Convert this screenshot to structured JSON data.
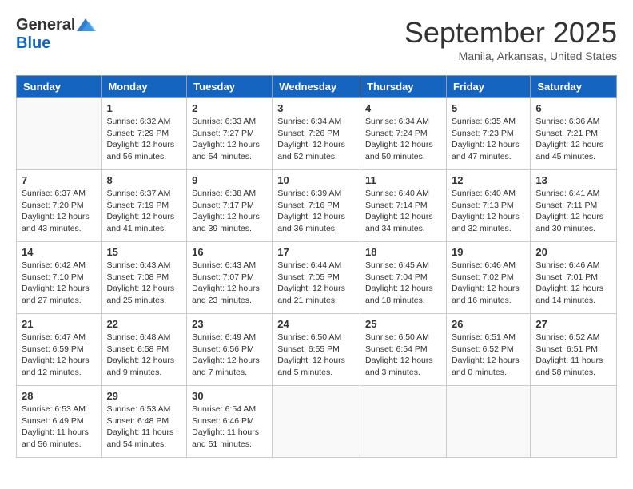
{
  "header": {
    "logo_general": "General",
    "logo_blue": "Blue",
    "title": "September 2025",
    "location": "Manila, Arkansas, United States"
  },
  "columns": [
    "Sunday",
    "Monday",
    "Tuesday",
    "Wednesday",
    "Thursday",
    "Friday",
    "Saturday"
  ],
  "weeks": [
    [
      {
        "day": "",
        "details": ""
      },
      {
        "day": "1",
        "details": "Sunrise: 6:32 AM\nSunset: 7:29 PM\nDaylight: 12 hours\nand 56 minutes."
      },
      {
        "day": "2",
        "details": "Sunrise: 6:33 AM\nSunset: 7:27 PM\nDaylight: 12 hours\nand 54 minutes."
      },
      {
        "day": "3",
        "details": "Sunrise: 6:34 AM\nSunset: 7:26 PM\nDaylight: 12 hours\nand 52 minutes."
      },
      {
        "day": "4",
        "details": "Sunrise: 6:34 AM\nSunset: 7:24 PM\nDaylight: 12 hours\nand 50 minutes."
      },
      {
        "day": "5",
        "details": "Sunrise: 6:35 AM\nSunset: 7:23 PM\nDaylight: 12 hours\nand 47 minutes."
      },
      {
        "day": "6",
        "details": "Sunrise: 6:36 AM\nSunset: 7:21 PM\nDaylight: 12 hours\nand 45 minutes."
      }
    ],
    [
      {
        "day": "7",
        "details": "Sunrise: 6:37 AM\nSunset: 7:20 PM\nDaylight: 12 hours\nand 43 minutes."
      },
      {
        "day": "8",
        "details": "Sunrise: 6:37 AM\nSunset: 7:19 PM\nDaylight: 12 hours\nand 41 minutes."
      },
      {
        "day": "9",
        "details": "Sunrise: 6:38 AM\nSunset: 7:17 PM\nDaylight: 12 hours\nand 39 minutes."
      },
      {
        "day": "10",
        "details": "Sunrise: 6:39 AM\nSunset: 7:16 PM\nDaylight: 12 hours\nand 36 minutes."
      },
      {
        "day": "11",
        "details": "Sunrise: 6:40 AM\nSunset: 7:14 PM\nDaylight: 12 hours\nand 34 minutes."
      },
      {
        "day": "12",
        "details": "Sunrise: 6:40 AM\nSunset: 7:13 PM\nDaylight: 12 hours\nand 32 minutes."
      },
      {
        "day": "13",
        "details": "Sunrise: 6:41 AM\nSunset: 7:11 PM\nDaylight: 12 hours\nand 30 minutes."
      }
    ],
    [
      {
        "day": "14",
        "details": "Sunrise: 6:42 AM\nSunset: 7:10 PM\nDaylight: 12 hours\nand 27 minutes."
      },
      {
        "day": "15",
        "details": "Sunrise: 6:43 AM\nSunset: 7:08 PM\nDaylight: 12 hours\nand 25 minutes."
      },
      {
        "day": "16",
        "details": "Sunrise: 6:43 AM\nSunset: 7:07 PM\nDaylight: 12 hours\nand 23 minutes."
      },
      {
        "day": "17",
        "details": "Sunrise: 6:44 AM\nSunset: 7:05 PM\nDaylight: 12 hours\nand 21 minutes."
      },
      {
        "day": "18",
        "details": "Sunrise: 6:45 AM\nSunset: 7:04 PM\nDaylight: 12 hours\nand 18 minutes."
      },
      {
        "day": "19",
        "details": "Sunrise: 6:46 AM\nSunset: 7:02 PM\nDaylight: 12 hours\nand 16 minutes."
      },
      {
        "day": "20",
        "details": "Sunrise: 6:46 AM\nSunset: 7:01 PM\nDaylight: 12 hours\nand 14 minutes."
      }
    ],
    [
      {
        "day": "21",
        "details": "Sunrise: 6:47 AM\nSunset: 6:59 PM\nDaylight: 12 hours\nand 12 minutes."
      },
      {
        "day": "22",
        "details": "Sunrise: 6:48 AM\nSunset: 6:58 PM\nDaylight: 12 hours\nand 9 minutes."
      },
      {
        "day": "23",
        "details": "Sunrise: 6:49 AM\nSunset: 6:56 PM\nDaylight: 12 hours\nand 7 minutes."
      },
      {
        "day": "24",
        "details": "Sunrise: 6:50 AM\nSunset: 6:55 PM\nDaylight: 12 hours\nand 5 minutes."
      },
      {
        "day": "25",
        "details": "Sunrise: 6:50 AM\nSunset: 6:54 PM\nDaylight: 12 hours\nand 3 minutes."
      },
      {
        "day": "26",
        "details": "Sunrise: 6:51 AM\nSunset: 6:52 PM\nDaylight: 12 hours\nand 0 minutes."
      },
      {
        "day": "27",
        "details": "Sunrise: 6:52 AM\nSunset: 6:51 PM\nDaylight: 11 hours\nand 58 minutes."
      }
    ],
    [
      {
        "day": "28",
        "details": "Sunrise: 6:53 AM\nSunset: 6:49 PM\nDaylight: 11 hours\nand 56 minutes."
      },
      {
        "day": "29",
        "details": "Sunrise: 6:53 AM\nSunset: 6:48 PM\nDaylight: 11 hours\nand 54 minutes."
      },
      {
        "day": "30",
        "details": "Sunrise: 6:54 AM\nSunset: 6:46 PM\nDaylight: 11 hours\nand 51 minutes."
      },
      {
        "day": "",
        "details": ""
      },
      {
        "day": "",
        "details": ""
      },
      {
        "day": "",
        "details": ""
      },
      {
        "day": "",
        "details": ""
      }
    ]
  ]
}
